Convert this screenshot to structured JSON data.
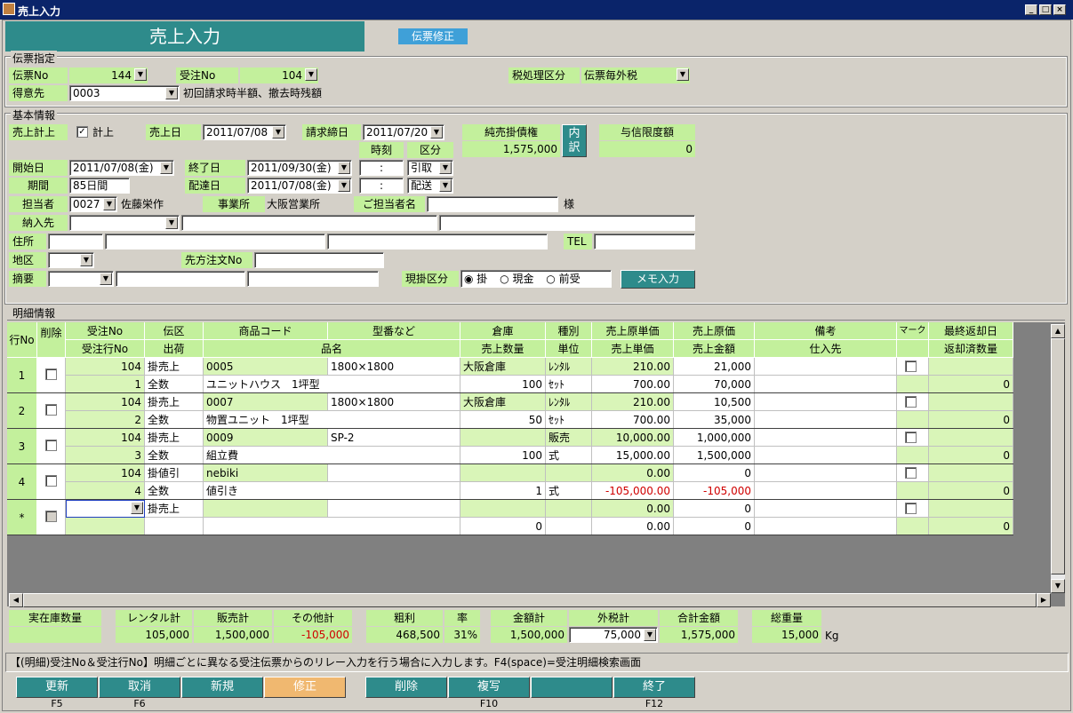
{
  "window": {
    "title": "売上入力",
    "min": "_",
    "max": "□",
    "close": "×"
  },
  "header": {
    "title": "売上入力",
    "mode": "伝票修正"
  },
  "slip": {
    "group": "伝票指定",
    "slip_no_label": "伝票No",
    "slip_no": "144",
    "order_no_label": "受注No",
    "order_no": "104",
    "tax_label": "税処理区分",
    "tax": "伝票毎外税",
    "customer_label": "得意先",
    "customer_code": "0003",
    "customer_note": "初回請求時半額、撤去時残額"
  },
  "basic": {
    "group": "基本情報",
    "sales_post_label": "売上計上",
    "sales_post_check": "✓",
    "sales_post_text": "計上",
    "sales_date_label": "売上日",
    "sales_date": "2011/07/08",
    "billing_label": "請求締日",
    "billing_date": "2011/07/20",
    "net_label": "純売掛債権",
    "net_value": "1,575,000",
    "breakdown_btn": "内\n訳",
    "credit_label": "与信限度額",
    "credit_value": "0",
    "time_label": "時刻",
    "kubun_label": "区分",
    "start_label": "開始日",
    "start_date": "2011/07/08(金)",
    "end_label": "終了日",
    "end_date": "2011/09/30(金)",
    "time1": ":",
    "kubun1": "引取",
    "period_label": "期間",
    "period": "85日間",
    "delivery_label": "配達日",
    "delivery_date": "2011/07/08(金)",
    "time2": ":",
    "kubun2": "配送",
    "staff_label": "担当者",
    "staff_code": "0027",
    "staff_name": "佐藤栄作",
    "office_label": "事業所",
    "office": "大阪営業所",
    "contact_label": "ご担当者名",
    "contact_suffix": "様",
    "ship_label": "納入先",
    "address_label": "住所",
    "tel_label": "TEL",
    "area_label": "地区",
    "ext_order_label": "先方注文No",
    "summary_label": "摘要",
    "pay_label": "現掛区分",
    "pay_opt1": "掛",
    "pay_opt2": "現金",
    "pay_opt3": "前受",
    "memo_btn": "メモ入力"
  },
  "detail": {
    "group": "明細情報",
    "headers_top": [
      "行No",
      "削除",
      "受注No",
      "伝区",
      "商品コード",
      "型番など",
      "倉庫",
      "種別",
      "売上原単価",
      "売上原価",
      "備考",
      "マーク",
      "最終返却日"
    ],
    "headers_bottom": [
      "受注行No",
      "出荷",
      "品名",
      "売上数量",
      "単位",
      "売上単価",
      "売上金額",
      "仕入先",
      "返却済数量"
    ],
    "rows": [
      {
        "no": "1",
        "order": "104",
        "den": "掛売上",
        "code": "0005",
        "model": "1800×1800",
        "wh": "大阪倉庫",
        "kind": "ﾚﾝﾀﾙ",
        "cost_unit": "210.00",
        "cost": "21,000",
        "line": "1",
        "ship": "全数",
        "name": "ユニットハウス　1坪型",
        "qty": "100",
        "unit": "ｾｯﾄ",
        "price": "700.00",
        "amount": "70,000",
        "ret": "0"
      },
      {
        "no": "2",
        "order": "104",
        "den": "掛売上",
        "code": "0007",
        "model": "1800×1800",
        "wh": "大阪倉庫",
        "kind": "ﾚﾝﾀﾙ",
        "cost_unit": "210.00",
        "cost": "10,500",
        "line": "2",
        "ship": "全数",
        "name": "物置ユニット　1坪型",
        "qty": "50",
        "unit": "ｾｯﾄ",
        "price": "700.00",
        "amount": "35,000",
        "ret": "0"
      },
      {
        "no": "3",
        "order": "104",
        "den": "掛売上",
        "code": "0009",
        "model": "SP-2",
        "wh": "",
        "kind": "販売",
        "cost_unit": "10,000.00",
        "cost": "1,000,000",
        "line": "3",
        "ship": "全数",
        "name": "組立費",
        "qty": "100",
        "unit": "式",
        "price": "15,000.00",
        "amount": "1,500,000",
        "ret": "0"
      },
      {
        "no": "4",
        "order": "104",
        "den": "掛値引",
        "code": "nebiki",
        "model": "",
        "wh": "",
        "kind": "",
        "cost_unit": "0.00",
        "cost": "0",
        "line": "4",
        "ship": "全数",
        "name": "値引き",
        "qty": "1",
        "unit": "式",
        "price": "-105,000.00",
        "amount": "-105,000",
        "ret": "0"
      },
      {
        "no": "*",
        "order": "",
        "den": "掛売上",
        "code": "",
        "model": "",
        "wh": "",
        "kind": "",
        "cost_unit": "0.00",
        "cost": "0",
        "line": "",
        "ship": "",
        "name": "",
        "qty": "0",
        "unit": "",
        "price": "0.00",
        "amount": "0",
        "ret": "0"
      }
    ]
  },
  "totals": {
    "stock_label": "実在庫数量",
    "stock": "",
    "rental_label": "レンタル計",
    "rental": "105,000",
    "sales_label": "販売計",
    "sales": "1,500,000",
    "other_label": "その他計",
    "other": "-105,000",
    "profit_label": "粗利",
    "profit": "468,500",
    "rate_label": "率",
    "rate": "31%",
    "amount_label": "金額計",
    "amount": "1,500,000",
    "tax_label": "外税計",
    "tax": "75,000",
    "total_label": "合計金額",
    "total": "1,575,000",
    "weight_label": "総重量",
    "weight": "15,000",
    "weight_unit": "Kg"
  },
  "status": "【(明細)受注No＆受注行No】明細ごとに異なる受注伝票からのリレー入力を行う場合に入力します。F4(space)=受注明細検索画面",
  "fbuttons": [
    {
      "label": "更新",
      "key": "F5"
    },
    {
      "label": "取消",
      "key": "F6"
    },
    {
      "label": "新規",
      "key": ""
    },
    {
      "label": "修正",
      "key": ""
    },
    {
      "label": "削除",
      "key": ""
    },
    {
      "label": "複写",
      "key": "F10"
    },
    {
      "label": "",
      "key": ""
    },
    {
      "label": "終了",
      "key": "F12"
    }
  ],
  "colors": {
    "teal": "#2e8b8b",
    "green": "#c3f09c",
    "active": "#f0b870",
    "red": "#d00000"
  }
}
